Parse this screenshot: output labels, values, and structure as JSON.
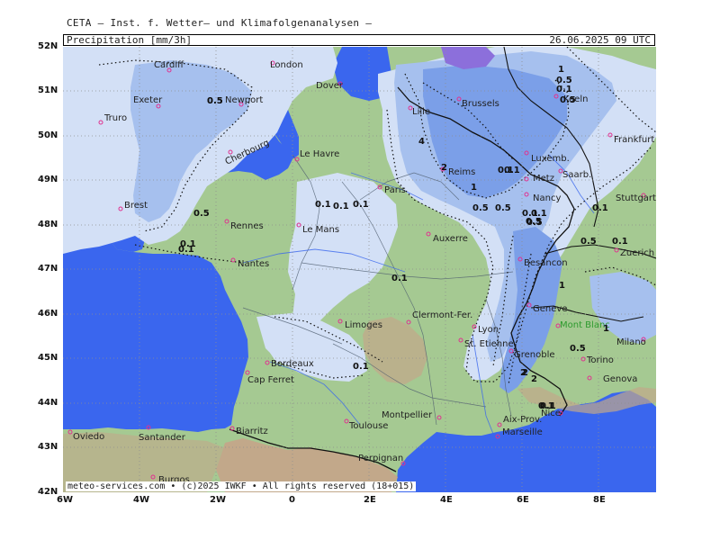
{
  "header": {
    "credit": "CETA — Inst. f. Wetter— und Klimafolgenanalysen —",
    "title": "Precipitation [mm/3h]",
    "timestamp": "26.06.2025 09 UTC"
  },
  "footer": "meteo-services.com • (c)2025 IWKF • All rights reserved (18+015)",
  "axes": {
    "lat_labels": [
      "52N",
      "51N",
      "50N",
      "49N",
      "48N",
      "47N",
      "46N",
      "45N",
      "44N",
      "43N",
      "42N"
    ],
    "lon_labels": [
      "6W",
      "4W",
      "2W",
      "0",
      "2E",
      "4E",
      "6E",
      "8E"
    ]
  },
  "cities": [
    "Cardiff",
    "London",
    "Dover",
    "Exeter",
    "Newport",
    "Truro",
    "Lille",
    "Brussels",
    "Koeln",
    "Frankfurt",
    "Cherbourg",
    "Le Havre",
    "Luxemb.",
    "Saarb.",
    "Brest",
    "Paris",
    "Reims",
    "Metz",
    "Nancy",
    "Stuttgart",
    "Rennes",
    "Le Mans",
    "Auxerre",
    "Zuerich",
    "Nantes",
    "Besancon",
    "Geneve",
    "Clermont-Fer.",
    "Limoges",
    "Lyon",
    "St. Etienne",
    "Mont Blanc",
    "Milano",
    "Grenoble",
    "Bordeaux",
    "Torino",
    "Cap Ferret",
    "Genova",
    "Nice",
    "Montpellier",
    "Toulouse",
    "Aix-Prov.",
    "Biarritz",
    "Marseille",
    "Oviedo",
    "Santander",
    "Perpignan",
    "Burgos"
  ],
  "values": [
    "0.5",
    "0.1",
    "1",
    "0.5",
    "0.1",
    "0.5",
    "0.1",
    "0.5",
    "0.1",
    "4",
    "2",
    "0.1",
    "1",
    "0.5",
    "0.1",
    "0.5",
    "0.1",
    "0.5",
    "0.1",
    "1",
    "0.1",
    "1",
    "0.5",
    "2",
    "0.1",
    "0.1",
    "0.1",
    "0.5",
    "0.1",
    "0.1",
    "0.5",
    "0.1",
    "0.5",
    "2",
    "0.1",
    "2"
  ],
  "colors": {
    "sea": "#3a66ee",
    "land": "#a5c992",
    "precip_light": "#d3e0f6",
    "precip_moderate": "#a6c0ee",
    "precip_heavy": "#7b9fe8",
    "precip_intense": "#8c6fdb",
    "mountain": "#c2a88a"
  }
}
